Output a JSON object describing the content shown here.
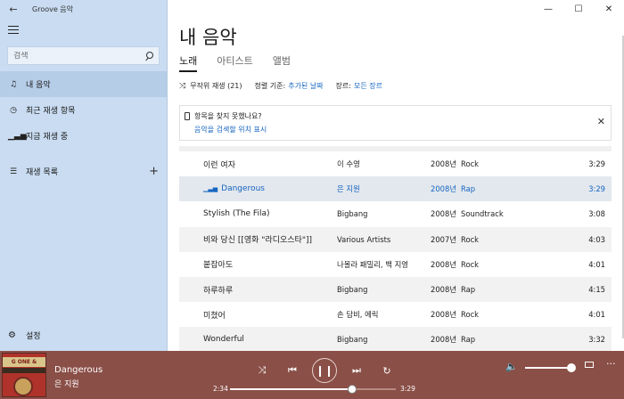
{
  "window": {
    "title": "Groove 음악"
  },
  "sidebar": {
    "search_placeholder": "검색",
    "items": [
      {
        "label": "내 음악",
        "icon": "music-note-icon",
        "active": true
      },
      {
        "label": "최근 재생 항목",
        "icon": "clock-icon",
        "active": false
      },
      {
        "label": "지금 재생 중",
        "icon": "equalizer-icon",
        "active": false
      },
      {
        "label": "재생 목록",
        "icon": "playlist-icon",
        "active": false
      }
    ],
    "settings_label": "설정"
  },
  "main": {
    "title": "내 음악",
    "tabs": [
      {
        "label": "노래",
        "active": true
      },
      {
        "label": "아티스트",
        "active": false
      },
      {
        "label": "앨범",
        "active": false
      }
    ],
    "toolbar": {
      "shuffle_label": "무작위 재생 (21)",
      "sort_label": "정렬 기준:",
      "sort_value": "추가된 날짜",
      "genre_label": "장르:",
      "genre_value": "모든 장르"
    },
    "banner": {
      "question": "항목을 찾지 못했나요?",
      "link": "음악을 검색할 위치 표시"
    },
    "songs": [
      {
        "title": "이런 여자",
        "artist": "이 수영",
        "year": "2008년",
        "genre": "Rock",
        "duration": "3:29"
      },
      {
        "title": "Dangerous",
        "artist": "은 지원",
        "year": "2008년",
        "genre": "Rap",
        "duration": "3:29",
        "playing": true
      },
      {
        "title": "Stylish (The Fila)",
        "artist": "Bigbang",
        "year": "2008년",
        "genre": "Soundtrack",
        "duration": "3:08"
      },
      {
        "title": "비와 당신 [[영화 \"라디오스타\"]]",
        "artist": "Various Artists",
        "year": "2007년",
        "genre": "Rock",
        "duration": "4:03"
      },
      {
        "title": "붙잡아도",
        "artist": "나몰라 패밀리, 백 지영",
        "year": "2008년",
        "genre": "Rock",
        "duration": "4:01"
      },
      {
        "title": "하루하루",
        "artist": "Bigbang",
        "year": "2008년",
        "genre": "Rap",
        "duration": "4:15"
      },
      {
        "title": "미쳤어",
        "artist": "손 담비, 에릭",
        "year": "2008년",
        "genre": "Rock",
        "duration": "4:01"
      },
      {
        "title": "Wonderful",
        "artist": "Bigbang",
        "year": "2008년",
        "genre": "Rap",
        "duration": "3:32"
      }
    ]
  },
  "player": {
    "title": "Dangerous",
    "artist": "은 지원",
    "elapsed": "2:34",
    "total": "3:29",
    "progress": 0.737,
    "volume": 1.0,
    "album_art_text": "G ONE & CODE"
  },
  "colors": {
    "sidebar_bg": "#c9dcf1",
    "accent": "#1565c0",
    "player_bg": "#8a4f47"
  }
}
